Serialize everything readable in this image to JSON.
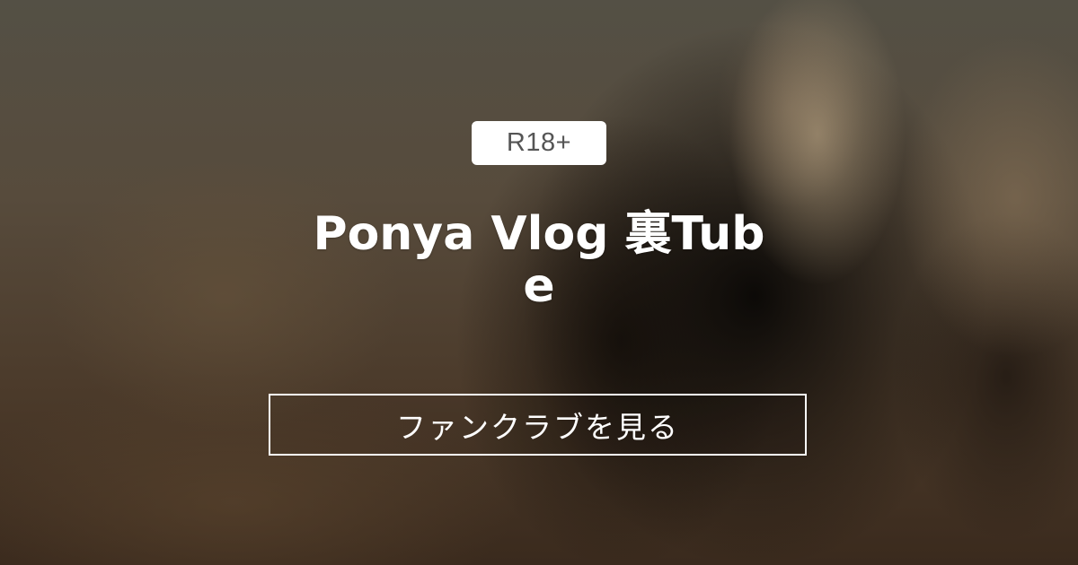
{
  "badge": {
    "label": "R18+"
  },
  "fanclub": {
    "title": "Ponya Vlog 裏Tube"
  },
  "cta": {
    "label": "ファンクラブを見る"
  },
  "colors": {
    "text": "#ffffff",
    "badge_background": "#ffffff",
    "badge_text": "#555555",
    "button_border": "#ffffff",
    "background_dark": "#2a2119"
  }
}
